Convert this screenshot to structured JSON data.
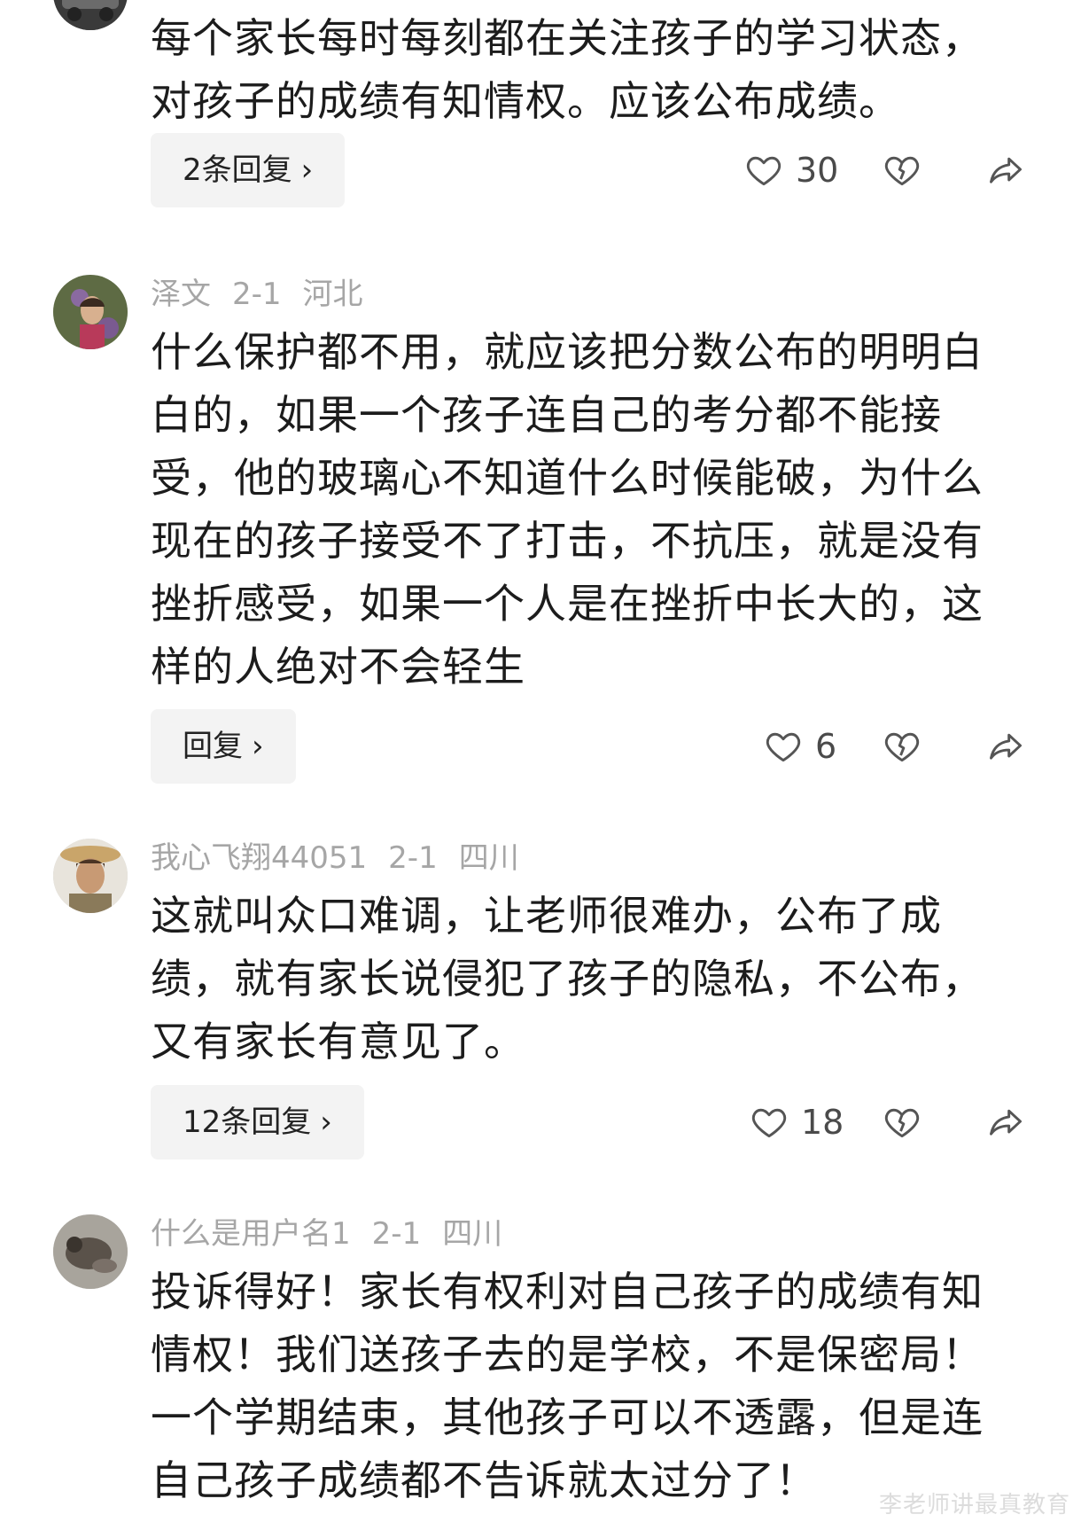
{
  "comments": [
    {
      "author": "",
      "date": "",
      "location": "",
      "text": "每个家长每时每刻都在关注孩子的学习状态，对孩子的成绩有知情权。应该公布成绩。",
      "replies": "2条回复",
      "likes": "30"
    },
    {
      "author": "泽文",
      "date": "2-1",
      "location": "河北",
      "text": "什么保护都不用，就应该把分数公布的明明白白的，如果一个孩子连自己的考分都不能接受，他的玻璃心不知道什么时候能破，为什么现在的孩子接受不了打击，不抗压，就是没有挫折感受，如果一个人是在挫折中长大的，这样的人绝对不会轻生",
      "replies": "回复",
      "likes": "6"
    },
    {
      "author": "我心飞翔44051",
      "date": "2-1",
      "location": "四川",
      "text": "这就叫众口难调，让老师很难办，公布了成绩，就有家长说侵犯了孩子的隐私，不公布，又有家长有意见了。",
      "replies": "12条回复",
      "likes": "18"
    },
    {
      "author": "什么是用户名1",
      "date": "2-1",
      "location": "四川",
      "text": "投诉得好！家长有权利对自己孩子的成绩有知情权！我们送孩子去的是学校，不是保密局！一个学期结束，其他孩子可以不透露，但是连自己孩子成绩都不告诉就太过分了！"
    }
  ],
  "chevron": "›",
  "watermark": "李老师讲最真教育",
  "colors": {
    "meta": "#a6a6a6",
    "text": "#1c1c1c",
    "button_bg": "#f3f3f3",
    "icon": "#555555"
  },
  "icons": [
    "heart-outline-icon",
    "broken-heart-icon",
    "share-arrow-icon"
  ]
}
